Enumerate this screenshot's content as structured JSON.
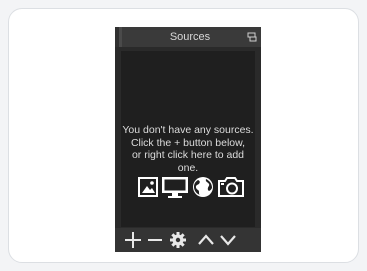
{
  "dock": {
    "title": "Sources",
    "title_button_icon": "float-dock-icon"
  },
  "empty_state": {
    "line1": "You don't have any sources.",
    "line2": "Click the + button below,",
    "line3": "or right click here to add one.",
    "icons": [
      "image-icon",
      "display-icon",
      "globe-icon",
      "camera-icon"
    ]
  },
  "toolbar": {
    "buttons": [
      "add-icon",
      "remove-icon",
      "properties-gear-icon",
      "move-up-icon",
      "move-down-icon"
    ]
  },
  "colors": {
    "panel_bg": "#2a2a2a",
    "list_bg": "#1f1f1f",
    "title_bg": "#3a3a3a",
    "toolbar_bg": "#343434",
    "text": "#dcdcdc"
  }
}
